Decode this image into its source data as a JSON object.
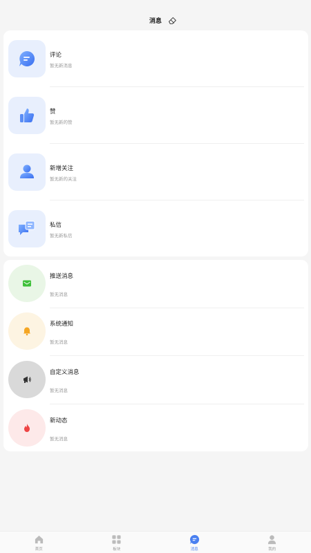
{
  "header": {
    "title": "消息"
  },
  "interactions": [
    {
      "name": "评论",
      "sub": "暂无新消息"
    },
    {
      "name": "赞",
      "sub": "暂无新的赞"
    },
    {
      "name": "新增关注",
      "sub": "暂无新的关注"
    },
    {
      "name": "私信",
      "sub": "暂无新私信"
    }
  ],
  "notifications": [
    {
      "name": "推送消息",
      "sub": "暂无消息",
      "icon": "envelope-icon",
      "bg": "#e9f6e6",
      "color": "#3fc03a"
    },
    {
      "name": "系统通知",
      "sub": "暂无消息",
      "icon": "bell-icon",
      "bg": "#fdf4e2",
      "color": "#f5a623"
    },
    {
      "name": "自定义消息",
      "sub": "暂无消息",
      "icon": "megaphone-icon",
      "bg": "#d9d9d9",
      "color": "#333333"
    },
    {
      "name": "新动态",
      "sub": "暂无消息",
      "icon": "flame-icon",
      "bg": "#fde9e9",
      "color": "#ee4444"
    }
  ],
  "tabs": [
    {
      "label": "首页",
      "icon": "home-icon",
      "active": false
    },
    {
      "label": "板块",
      "icon": "grid-icon",
      "active": false
    },
    {
      "label": "消息",
      "icon": "chat-icon",
      "active": true
    },
    {
      "label": "我的",
      "icon": "user-icon",
      "active": false
    }
  ],
  "colors": {
    "accent": "#4a80f0",
    "inactive": "#bbbbbb"
  }
}
